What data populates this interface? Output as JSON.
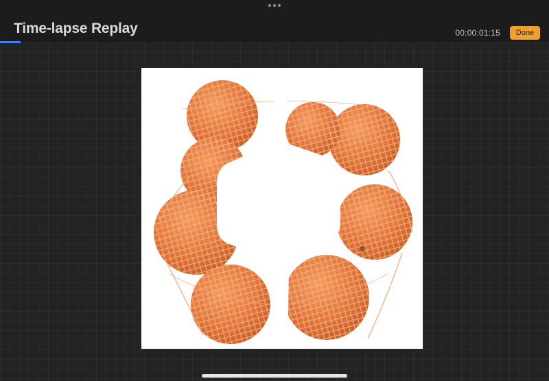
{
  "app": {
    "title": "Time-lapse Replay",
    "timecode": "00:00:01:15",
    "done_label": "Done"
  },
  "playback": {
    "progress_fraction": 0.037
  },
  "artwork": {
    "subject": "Oranges in a mesh net bag with white cardboard label"
  },
  "colors": {
    "accent": "#f0a02a",
    "progress": "#3b7ff0",
    "orange_fill": "#e47a3a",
    "net": "#f2a77a"
  }
}
